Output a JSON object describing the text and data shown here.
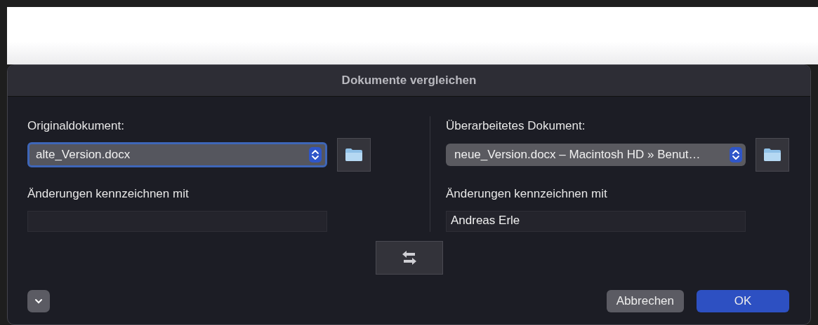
{
  "dialog": {
    "title": "Dokumente vergleichen"
  },
  "columns": [
    {
      "label": "Originaldokument:",
      "document": "alte_Version.docx",
      "focused": true,
      "mark_label": "Änderungen kennzeichnen mit"
    },
    {
      "label": "Überarbeitetes Dokument:",
      "document": "neue_Version.docx – Macintosh HD » Benut…",
      "focused": false,
      "mark_label": "Änderungen kennzeichnen mit",
      "mark_value": "Andreas Erle"
    }
  ],
  "buttons": [
    {
      "label": "Abbrechen",
      "default": false
    },
    {
      "label": "OK",
      "default": true
    }
  ]
}
